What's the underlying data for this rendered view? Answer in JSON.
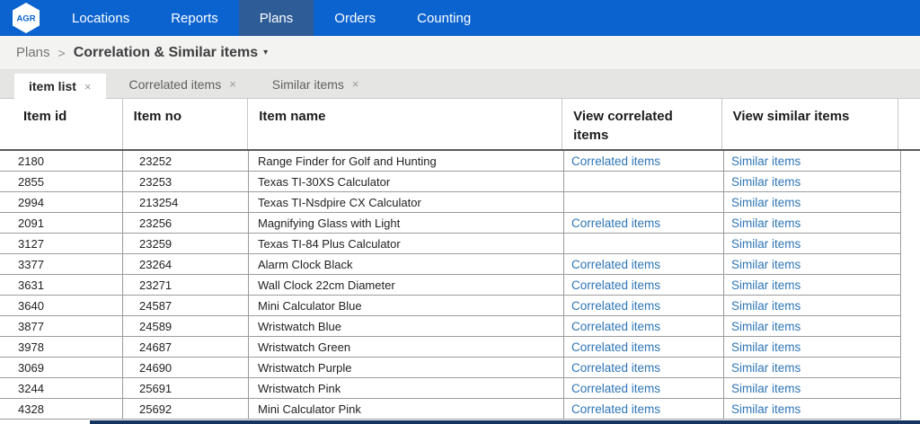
{
  "nav": {
    "brand": "AGR",
    "items": [
      {
        "label": "Locations"
      },
      {
        "label": "Reports"
      },
      {
        "label": "Plans"
      },
      {
        "label": "Orders"
      },
      {
        "label": "Counting"
      }
    ]
  },
  "breadcrumb": {
    "root": "Plans",
    "separator": ">",
    "current": "Correlation & Similar items",
    "caret": "▾"
  },
  "tabs": [
    {
      "label": "item list",
      "close": "×"
    },
    {
      "label": "Correlated items",
      "close": "×"
    },
    {
      "label": "Similar items",
      "close": "×"
    }
  ],
  "table": {
    "headers": [
      "Item id",
      "Item no",
      "Item name",
      "View correlated items",
      "View similar items"
    ],
    "correlated_link_label": "Correlated items",
    "similar_link_label": "Similar items",
    "rows": [
      {
        "id": "2180",
        "no": "23252",
        "name": "Range Finder for Golf and Hunting",
        "has_correlated": true,
        "has_similar": true
      },
      {
        "id": "2855",
        "no": "23253",
        "name": "Texas TI-30XS Calculator",
        "has_correlated": false,
        "has_similar": true
      },
      {
        "id": "2994",
        "no": "213254",
        "name": "Texas TI-Nsdpire CX Calculator",
        "has_correlated": false,
        "has_similar": true
      },
      {
        "id": "2091",
        "no": "23256",
        "name": "Magnifying Glass with Light",
        "has_correlated": true,
        "has_similar": true
      },
      {
        "id": "3127",
        "no": "23259",
        "name": "Texas TI-84 Plus Calculator",
        "has_correlated": false,
        "has_similar": true
      },
      {
        "id": "3377",
        "no": "23264",
        "name": "Alarm Clock Black",
        "has_correlated": true,
        "has_similar": true
      },
      {
        "id": "3631",
        "no": "23271",
        "name": "Wall Clock 22cm Diameter",
        "has_correlated": true,
        "has_similar": true
      },
      {
        "id": "3640",
        "no": "24587",
        "name": "Mini Calculator Blue",
        "has_correlated": true,
        "has_similar": true
      },
      {
        "id": "3877",
        "no": "24589",
        "name": "Wristwatch Blue",
        "has_correlated": true,
        "has_similar": true
      },
      {
        "id": "3978",
        "no": "24687",
        "name": "Wristwatch Green",
        "has_correlated": true,
        "has_similar": true
      },
      {
        "id": "3069",
        "no": "24690",
        "name": "Wristwatch Purple",
        "has_correlated": true,
        "has_similar": true
      },
      {
        "id": "3244",
        "no": "25691",
        "name": "Wristwatch Pink",
        "has_correlated": true,
        "has_similar": true
      },
      {
        "id": "4328",
        "no": "25692",
        "name": "Mini Calculator Pink",
        "has_correlated": true,
        "has_similar": true
      }
    ]
  },
  "colors": {
    "nav_blue": "#0b63cf",
    "nav_active_blue": "#2d5c97",
    "link_blue": "#2e75b6",
    "bottom_bar_navy": "#15335f"
  }
}
